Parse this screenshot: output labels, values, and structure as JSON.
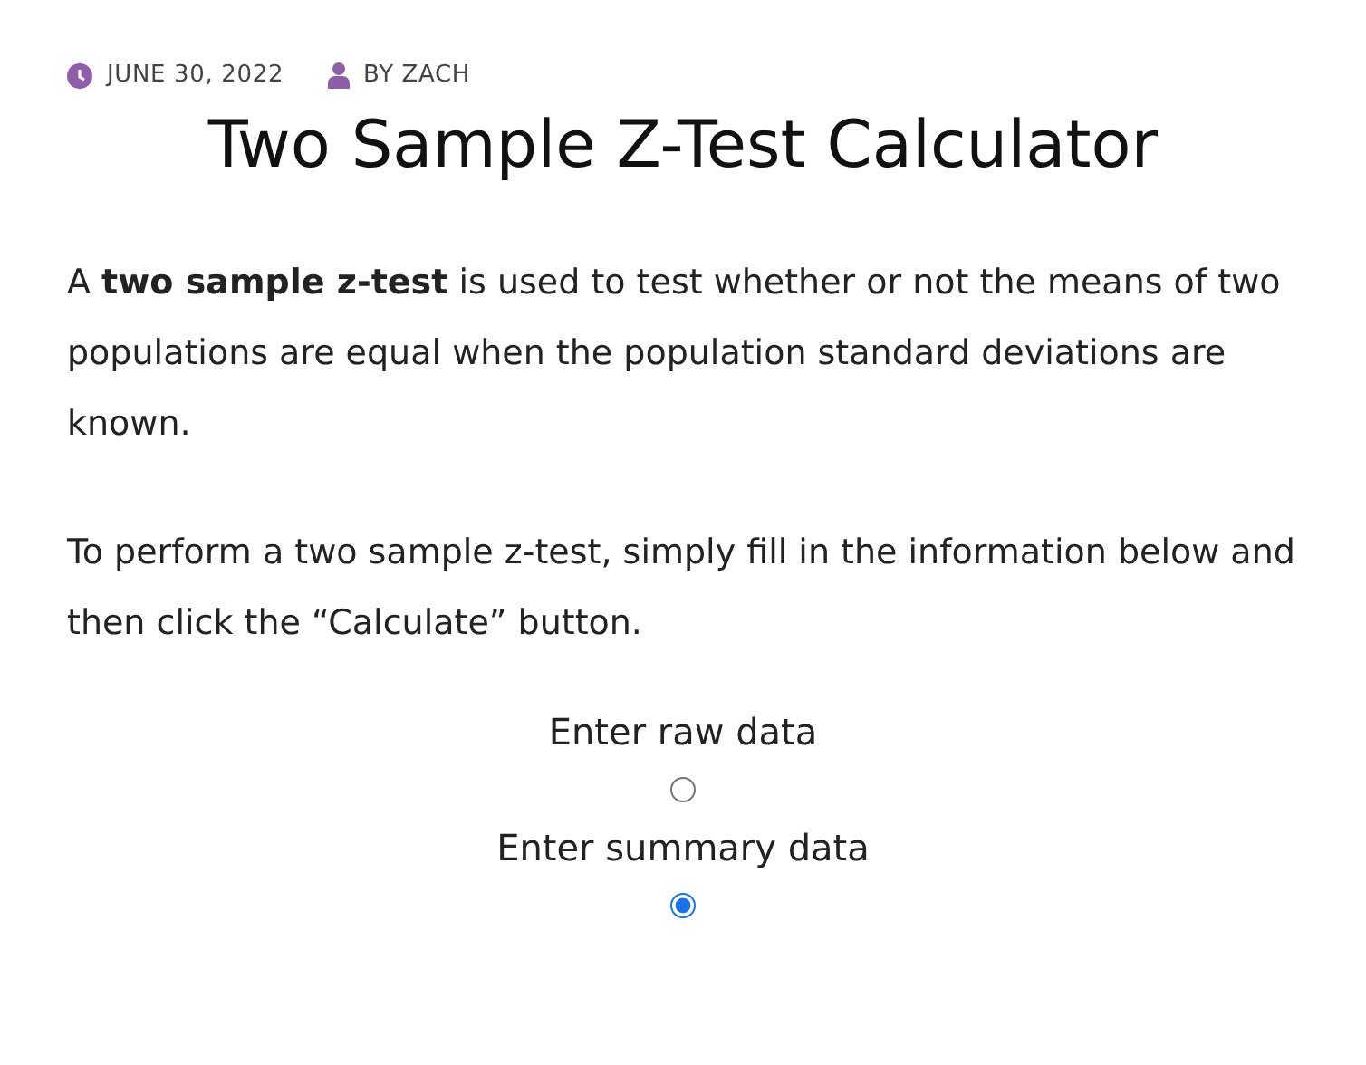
{
  "meta": {
    "date": "JUNE 30, 2022",
    "author": "BY ZACH"
  },
  "title": "Two Sample Z-Test Calculator",
  "paragraphs": [
    "A **two sample z-test** is used to test whether or not the means of two populations are equal when the population standard deviations are known.",
    "To perform a two sample z-test, simply fill in the information below and then click the “Calculate” button."
  ],
  "options": [
    {
      "label": "Enter raw data",
      "selected": false
    },
    {
      "label": "Enter summary data",
      "selected": true
    }
  ]
}
